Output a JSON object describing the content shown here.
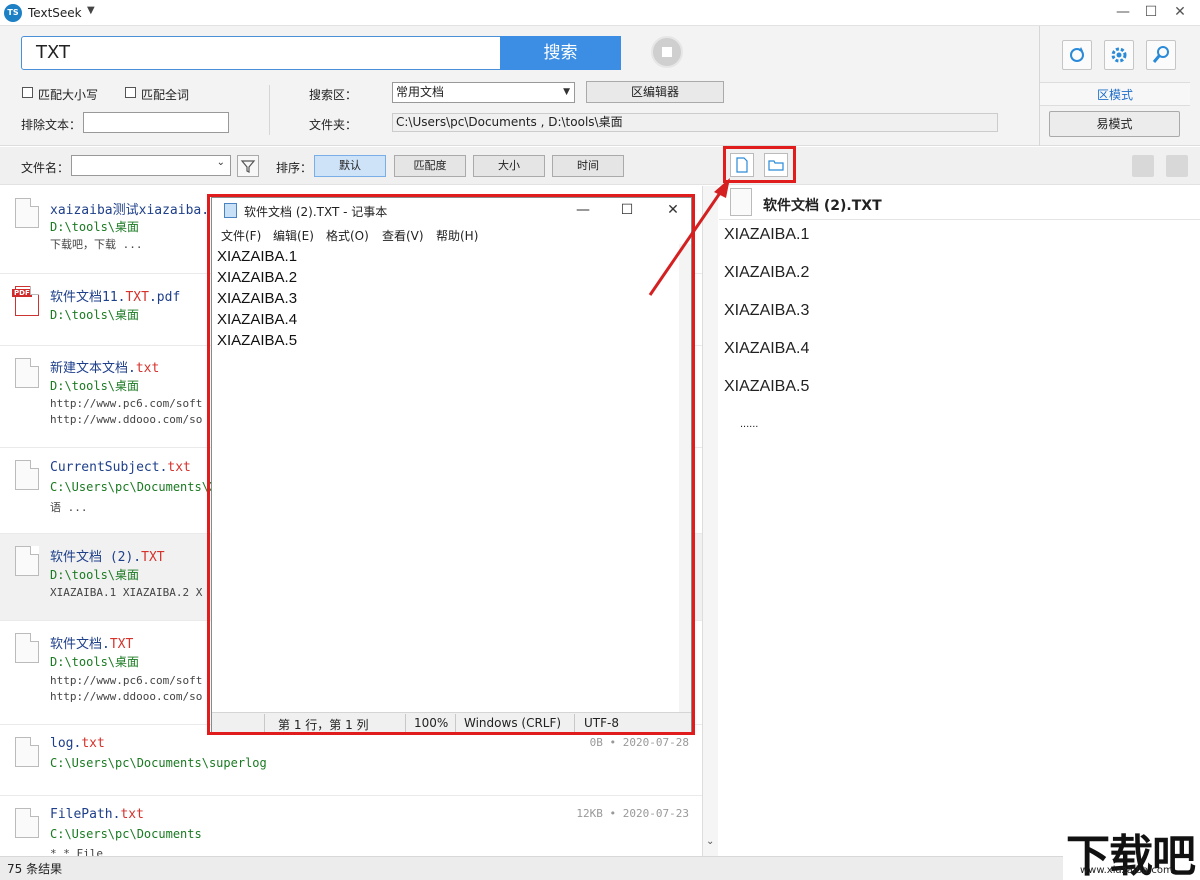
{
  "window": {
    "logo": "TS",
    "title": "TextSeek",
    "menu_caret": "▼",
    "minimize": "—",
    "maximize": "☐",
    "close": "✕"
  },
  "search": {
    "query": "TXT",
    "button_label": "搜索"
  },
  "options": {
    "match_case_label": "匹配大小写",
    "match_word_label": "匹配全词",
    "exclude_label": "排除文本：",
    "exclude_value": "",
    "zone_label": "搜索区：",
    "zone_value": "常用文档",
    "zone_editor_label": "区编辑器",
    "folder_label": "文件夹：",
    "folder_value": "C:\\Users\\pc\\Documents , D:\\tools\\桌面"
  },
  "modes": {
    "zone_mode": "区模式",
    "easy_mode": "易模式"
  },
  "toolbar": {
    "filename_label": "文件名：",
    "sort_label": "排序：",
    "sort_buttons": [
      "默认",
      "匹配度",
      "大小",
      "时间"
    ]
  },
  "results": [
    {
      "name": "xaizaiba测试xiazaiba.",
      "ext": "",
      "path": "D:\\tools\\桌面",
      "snippet1": "下载吧，下载 ...",
      "snippet2": "",
      "size": "",
      "date": ""
    },
    {
      "name": "软件文档11.",
      "ext": "TXT",
      "suffix": ".pdf",
      "path": "D:\\tools\\桌面",
      "snippet1": "",
      "snippet2": "",
      "size": "",
      "date": ""
    },
    {
      "name": "新建文本文档.",
      "ext": "txt",
      "path": "D:\\tools\\桌面",
      "snippet1": "http://www.pc6.com/soft",
      "snippet2": "http://www.ddooo.com/so",
      "size": "",
      "date": ""
    },
    {
      "name": "CurrentSubject.",
      "ext": "txt",
      "path": "C:\\Users\\pc\\Documents\\X",
      "snippet1": "语 ...",
      "snippet2": "",
      "size": "",
      "date": ""
    },
    {
      "name": "软件文档 (2).",
      "ext": "TXT",
      "path": "D:\\tools\\桌面",
      "snippet1": "XIAZAIBA.1 XIAZAIBA.2 X",
      "snippet2": "",
      "size": "",
      "date": ""
    },
    {
      "name": "软件文档.",
      "ext": "TXT",
      "path": "D:\\tools\\桌面",
      "snippet1": "http://www.pc6.com/soft",
      "snippet2": "http://www.ddooo.com/so",
      "size": "",
      "date": ""
    },
    {
      "name": "log.",
      "ext": "txt",
      "path": "C:\\Users\\pc\\Documents\\superlog",
      "snippet1": "",
      "snippet2": "",
      "size": "0B",
      "date": "2020-07-28"
    },
    {
      "name": "FilePath.",
      "ext": "txt",
      "path": "C:\\Users\\pc\\Documents",
      "snippet1": "* * File",
      "snippet2": "",
      "size": "12KB",
      "date": "2020-07-23"
    }
  ],
  "meta_separator": "•",
  "preview": {
    "title": "软件文档 (2).TXT",
    "lines": [
      "XIAZAIBA.1",
      "XIAZAIBA.2",
      "XIAZAIBA.3",
      "XIAZAIBA.4",
      "XIAZAIBA.5"
    ],
    "ellipsis": "......"
  },
  "notepad": {
    "title": "软件文档 (2).TXT - 记事本",
    "menu": [
      "文件(F)",
      "编辑(E)",
      "格式(O)",
      "查看(V)",
      "帮助(H)"
    ],
    "lines": [
      "XIAZAIBA.1",
      "XIAZAIBA.2",
      "XIAZAIBA.3",
      "XIAZAIBA.4",
      "XIAZAIBA.5"
    ],
    "status_position": "第 1 行，第 1 列",
    "status_zoom": "100%",
    "status_eol": "Windows (CRLF)",
    "status_encoding": "UTF-8"
  },
  "status": {
    "count": "75 条结果"
  },
  "watermark": {
    "text": "下载吧",
    "url": "www.xiazaiba.com"
  },
  "colors": {
    "accent": "#3b8ee3",
    "highlight": "#e01c1c",
    "filename": "#1e3f8a",
    "extension": "#d6322c",
    "path": "#1a7a22"
  }
}
